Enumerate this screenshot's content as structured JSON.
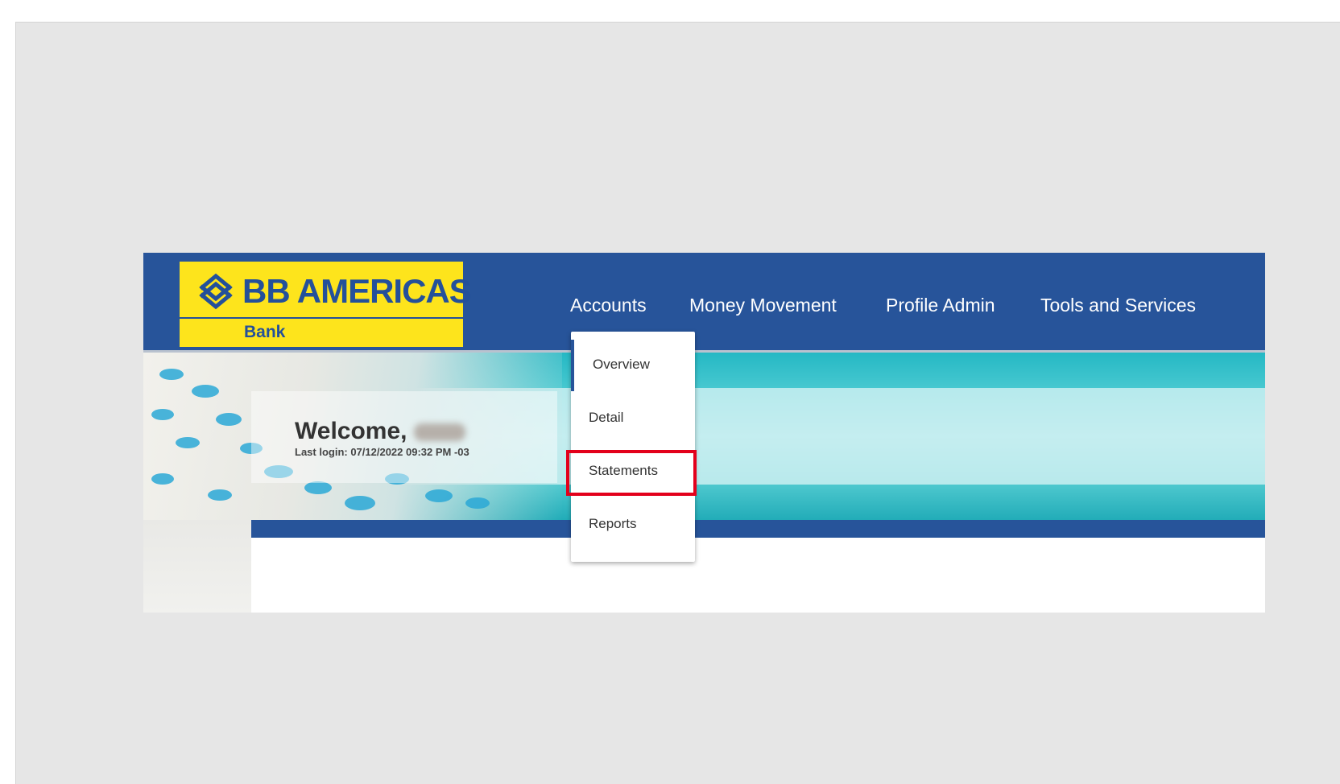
{
  "brand": {
    "name": "BB AMERICAS",
    "subtitle": "Bank",
    "colors": {
      "primary": "#27549a",
      "logo_background": "#fde41c",
      "highlight": "#e3001b"
    }
  },
  "nav": {
    "items": [
      {
        "label": "Accounts"
      },
      {
        "label": "Money Movement"
      },
      {
        "label": "Profile Admin"
      },
      {
        "label": "Tools and Services"
      }
    ]
  },
  "accounts_menu": {
    "items": [
      {
        "label": "Overview"
      },
      {
        "label": "Detail"
      },
      {
        "label": "Statements"
      },
      {
        "label": "Reports"
      }
    ],
    "highlighted": "Statements"
  },
  "welcome": {
    "greeting": "Welcome,",
    "last_login": "Last login: 07/12/2022 09:32 PM -03"
  }
}
